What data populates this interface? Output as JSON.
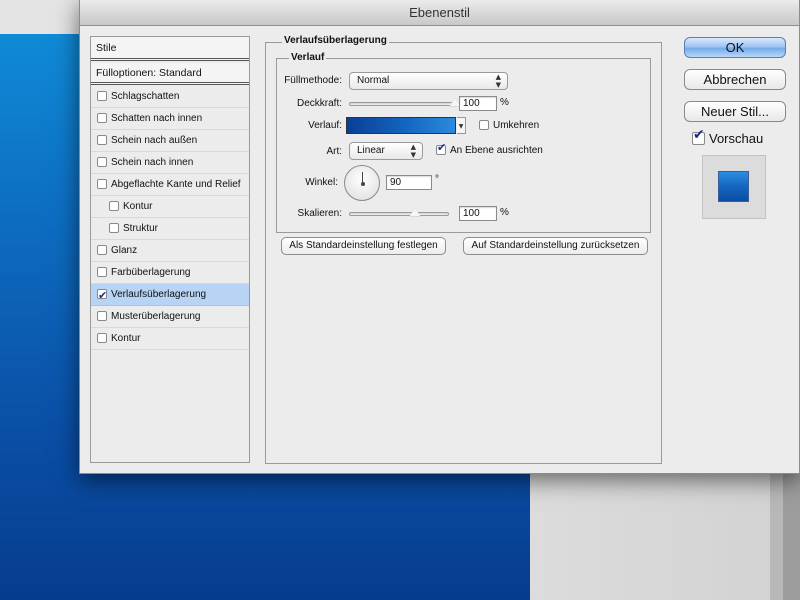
{
  "window": {
    "title": "Ebenenstil"
  },
  "sidebar": {
    "header": "Stile",
    "blend_options": "Fülloptionen: Standard",
    "items": [
      {
        "label": "Schlagschatten",
        "checked": false
      },
      {
        "label": "Schatten nach innen",
        "checked": false
      },
      {
        "label": "Schein nach außen",
        "checked": false
      },
      {
        "label": "Schein nach innen",
        "checked": false
      },
      {
        "label": "Abgeflachte Kante und Relief",
        "checked": false
      },
      {
        "label": "Kontur",
        "checked": false
      },
      {
        "label": "Struktur",
        "checked": false
      },
      {
        "label": "Glanz",
        "checked": false
      },
      {
        "label": "Farbüberlagerung",
        "checked": false
      },
      {
        "label": "Verlaufsüberlagerung",
        "checked": true
      },
      {
        "label": "Musterüberlagerung",
        "checked": false
      },
      {
        "label": "Kontur",
        "checked": false
      }
    ]
  },
  "panel": {
    "title": "Verlaufsüberlagerung",
    "group_title": "Verlauf",
    "blend_mode": {
      "label": "Füllmethode:",
      "value": "Normal"
    },
    "opacity": {
      "label": "Deckkraft:",
      "value": "100",
      "unit": "%",
      "slider_fraction": 1.0
    },
    "gradient": {
      "label": "Verlauf:",
      "colors": [
        "#0a3e96",
        "#1466c0",
        "#2a8bdc"
      ]
    },
    "reverse": {
      "label": "Umkehren",
      "checked": false
    },
    "style": {
      "label": "Art:",
      "value": "Linear"
    },
    "align_layer": {
      "label": "An Ebene ausrichten",
      "checked": true
    },
    "angle": {
      "label": "Winkel:",
      "value": "90",
      "unit": "°"
    },
    "scale": {
      "label": "Skalieren:",
      "value": "100",
      "unit": "%",
      "slider_fraction": 0.66
    },
    "make_default_button": "Als Standardeinstellung festlegen",
    "reset_default_button": "Auf Standardeinstellung zurücksetzen"
  },
  "actions": {
    "ok": "OK",
    "cancel": "Abbrechen",
    "new_style": "Neuer Stil...",
    "preview": {
      "label": "Vorschau",
      "checked": true
    }
  },
  "colors": {
    "accent": "#74abeb",
    "selection": "#b7d4f5",
    "canvas_blue": "#0d6bbf"
  }
}
